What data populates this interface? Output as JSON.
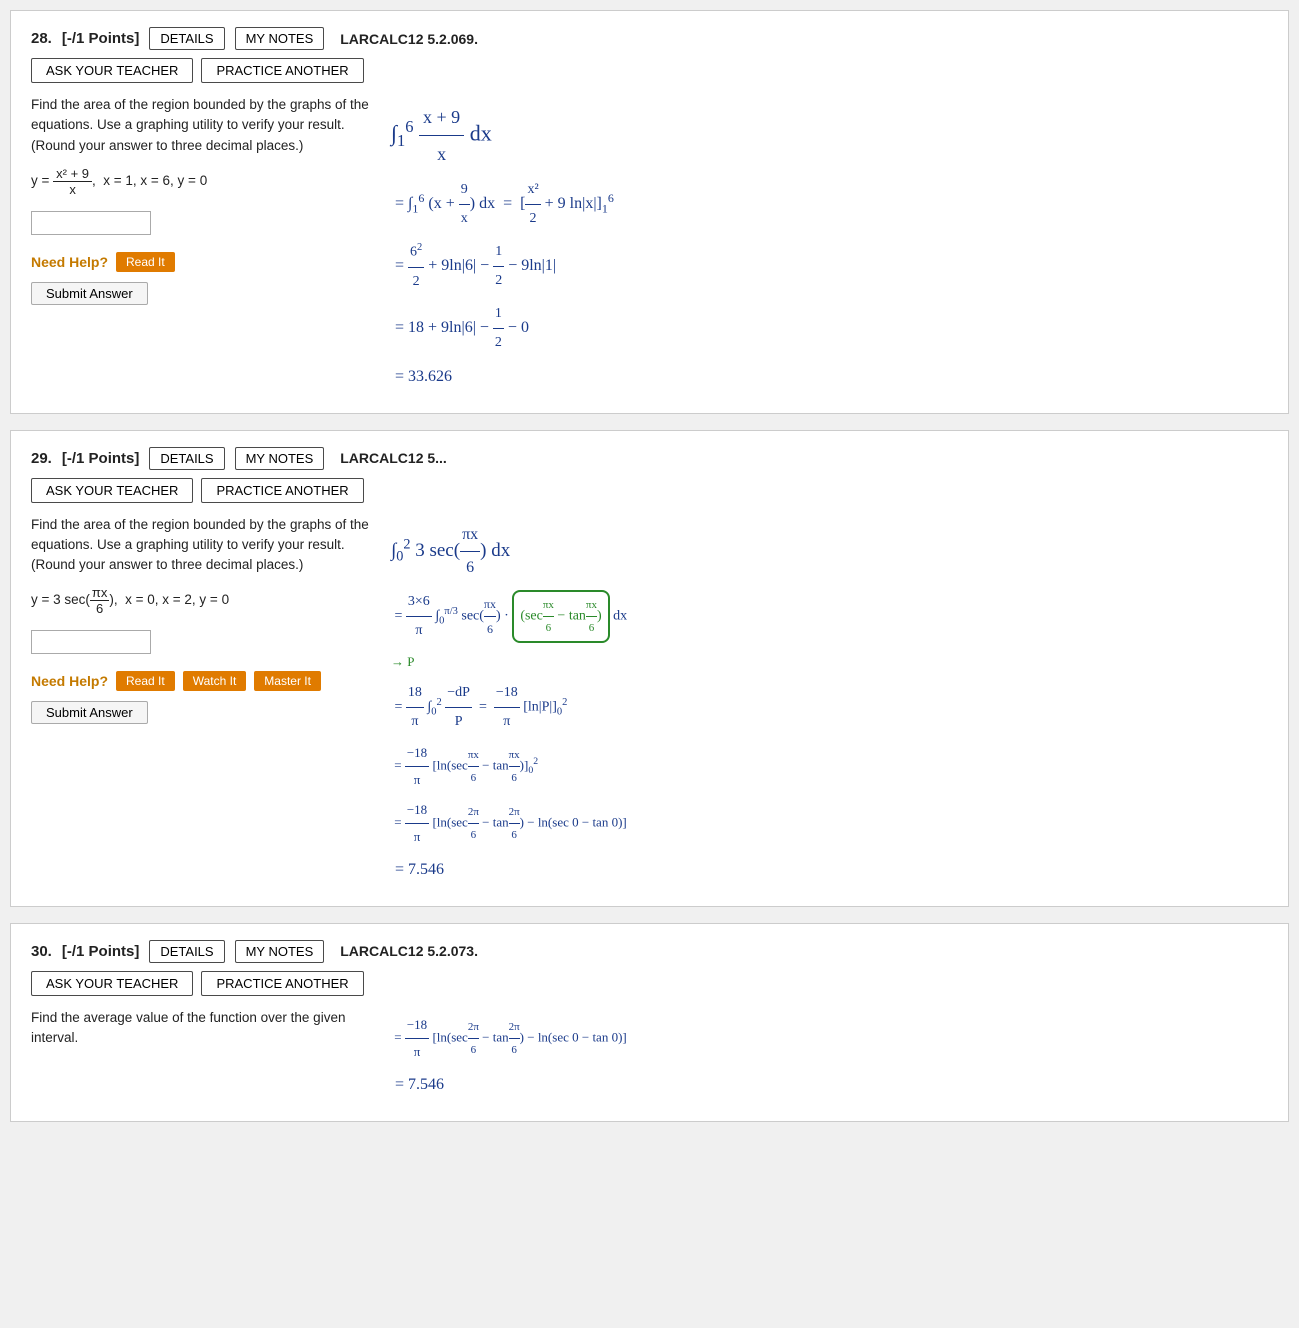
{
  "questions": [
    {
      "number": "28.",
      "points": "[-/1 Points]",
      "details_label": "DETAILS",
      "my_notes_label": "MY NOTES",
      "problem_id": "LARCALC12 5.2.069.",
      "ask_teacher_label": "ASK YOUR TEACHER",
      "practice_another_label": "PRACTICE ANOTHER",
      "problem_text": "Find the area of the region bounded by the graphs of the equations. Use a graphing utility to verify your result. (Round your answer to three decimal places.)",
      "equation": "y = (x² + 9) / x,  x = 1, x = 6, y = 0",
      "need_help_label": "Need Help?",
      "read_it_label": "Read It",
      "submit_label": "Submit Answer",
      "math_steps": [
        "∫₁⁶ (x + 9/x) dx",
        "= ∫₁⁶ (x + 9/x) dx = [x²/2 + 9 ln|x|]₁⁶",
        "= 6²/2 + 9ln|6| - 1/2 - 9ln|1|",
        "= 18 + 9ln|6| - 1/2 - 0",
        "= 33.626"
      ]
    },
    {
      "number": "29.",
      "points": "[-/1 Points]",
      "details_label": "DETAILS",
      "my_notes_label": "MY NOTES",
      "problem_id": "LARCALC12 5...",
      "ask_teacher_label": "ASK YOUR TEACHER",
      "practice_another_label": "PRACTICE ANOTHER",
      "problem_text": "Find the area of the region bounded by the graphs of the equations. Use a graphing utility to verify your result. (Round your answer to three decimal places.)",
      "equation": "y = 3 sec(πx/6),  x = 0, x = 2, y = 0",
      "need_help_label": "Need Help?",
      "read_it_label": "Read It",
      "watch_it_label": "Watch It",
      "master_it_label": "Master It",
      "submit_label": "Submit Answer",
      "math_steps": [
        "∫₀² 3 sec(πx/6) dx",
        "= 3×6/π ∫₀^(π/3) sec(πx/6)(sec(πx/6) - tan(πx/6)) / (sec(πx/6) - tan(πx/6)) dx",
        "→ P",
        "= 18/π ∫₀² -dP/P  =  -18/π [ln|P|]₀²",
        "= -18/π [ln(sec(πx/6) - tan(πx/6))]₀²",
        "= -18/π [ln(sec(2π/6) - tan(2π/6)) - ln(sec(0) - tan(0))]",
        "= 7.546"
      ]
    },
    {
      "number": "30.",
      "points": "[-/1 Points]",
      "details_label": "DETAILS",
      "my_notes_label": "MY NOTES",
      "problem_id": "LARCALC12 5.2.073.",
      "ask_teacher_label": "ASK YOUR TEACHER",
      "practice_another_label": "PRACTICE ANOTHER",
      "problem_text": "Find the average value of the function over the given interval.",
      "math_steps": [
        "= 7.546"
      ]
    }
  ]
}
